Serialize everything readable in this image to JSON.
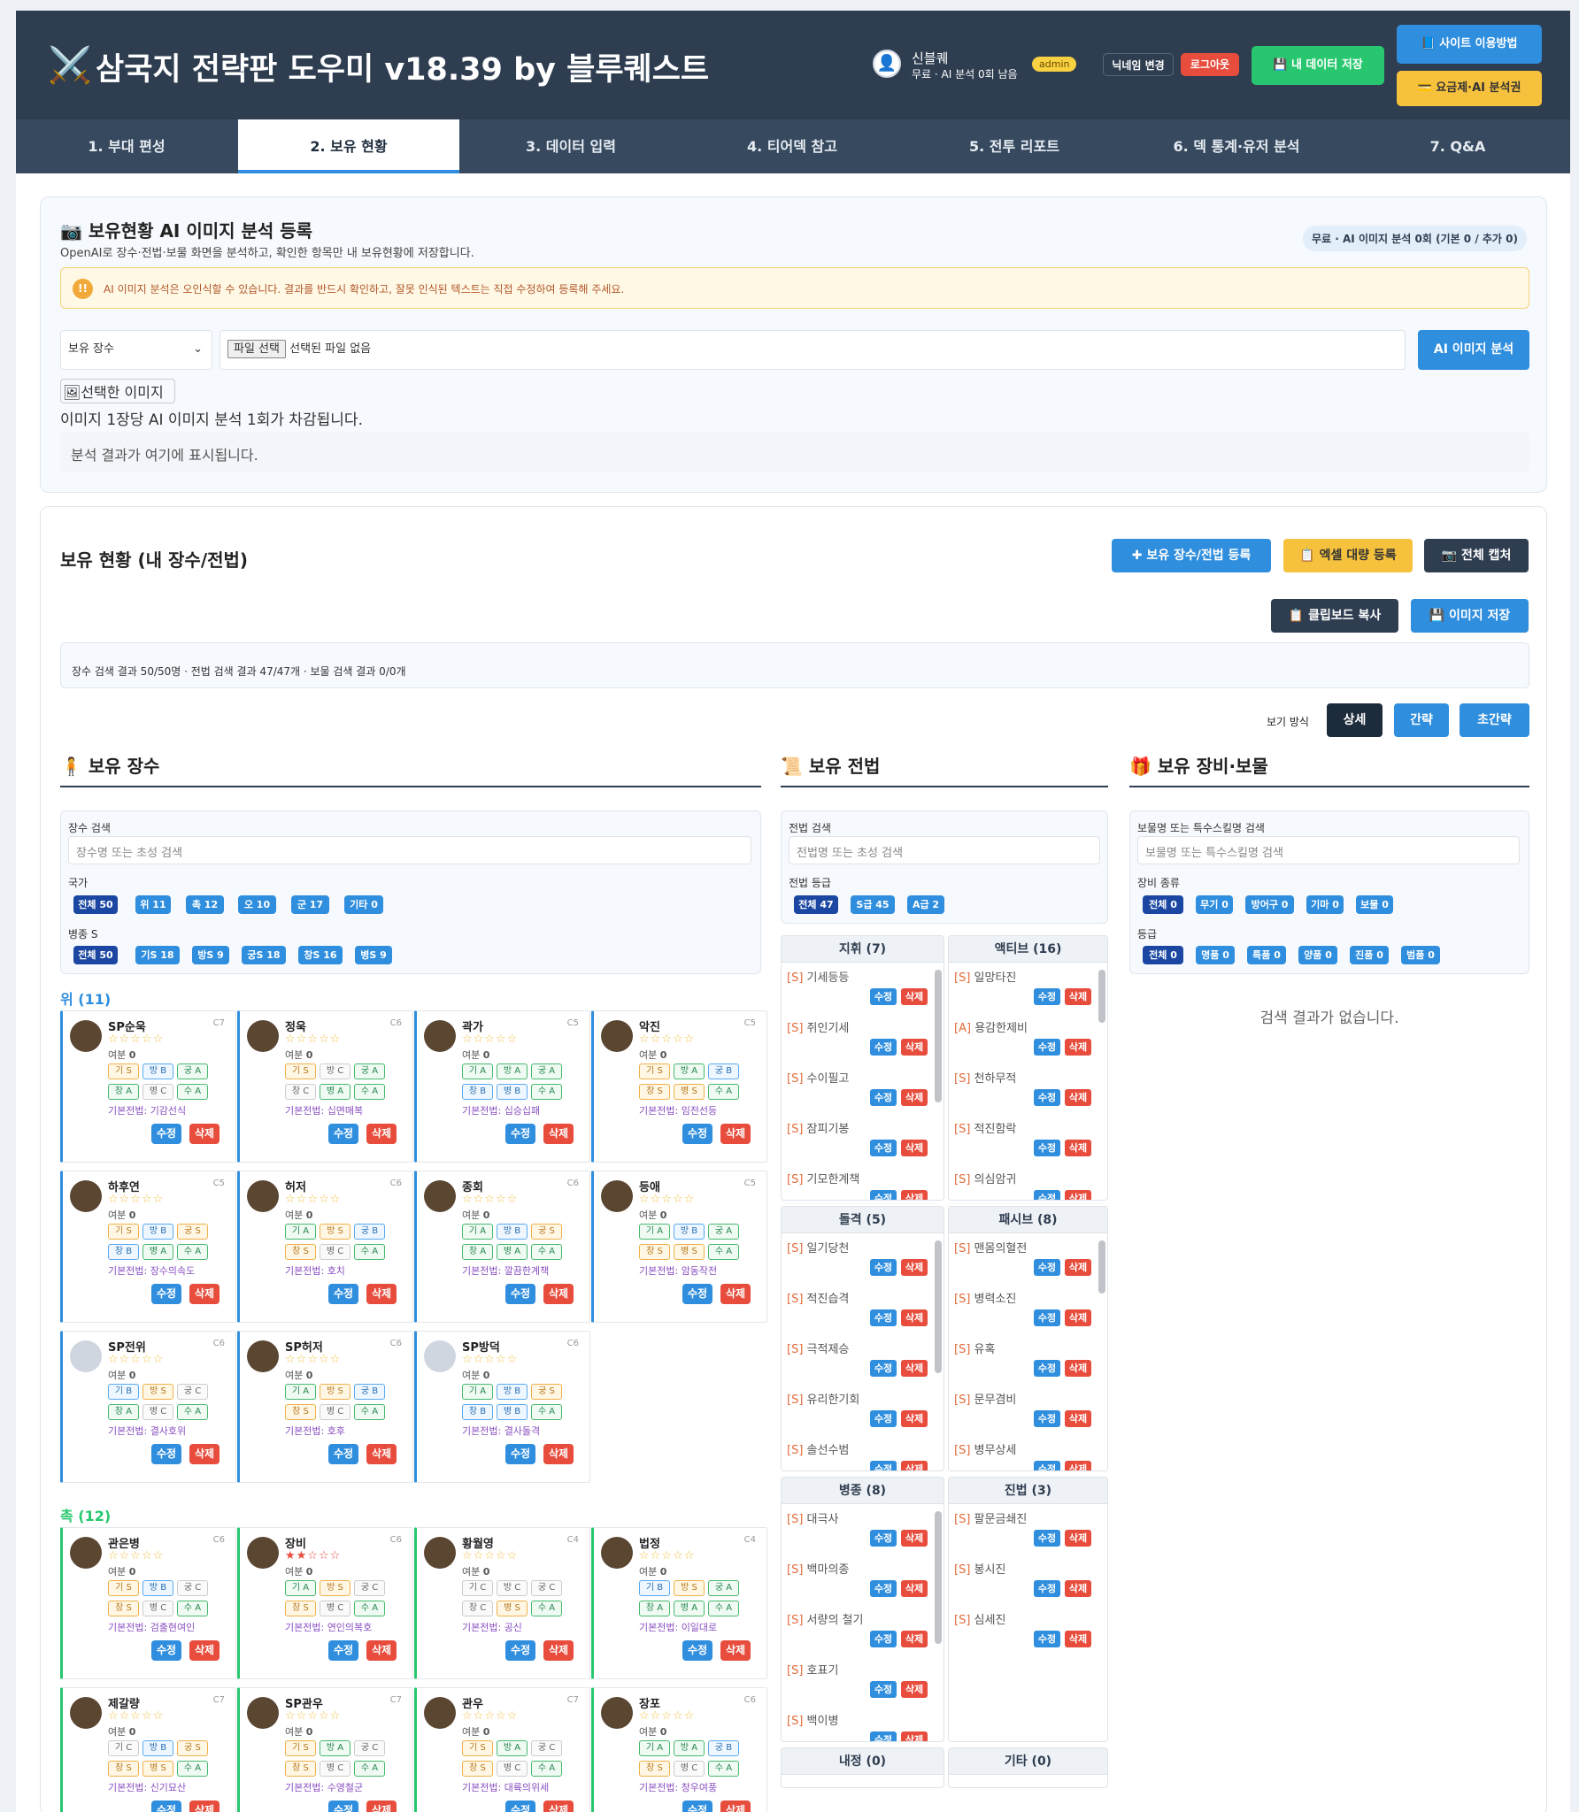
{
  "app": {
    "title": "삼국지 전략판 도우미 v18.39 by 블루퀘스트",
    "user": "신블퀘",
    "quota": "무료 · AI 분석 0회 남음",
    "role": "admin",
    "rename": "닉네임 변경",
    "logout": "로그아웃",
    "save_data": "💾 내 데이터 저장",
    "how_to": "📘 사이트 이용방법",
    "plans": "💳 요금제·AI 분석권"
  },
  "tabs": [
    "1. 부대 편성",
    "2. 보유 현황",
    "3. 데이터 입력",
    "4. 티어덱 참고",
    "5. 전투 리포트",
    "6. 덱 통계·유저 분석",
    "7. Q&A"
  ],
  "ai": {
    "title": "보유현황 AI 이미지 분석 등록",
    "desc": "OpenAI로 장수·전법·보물 화면을 분석하고, 확인한 항목만 내 보유현황에 저장합니다.",
    "badge": "무료 · AI 이미지 분석 0회 (기본 0 / 추가 0)",
    "warn": "AI 이미지 분석은 오인식할 수 있습니다. 결과를 반드시 확인하고, 잘못 인식된 텍스트는 직접 수정하여 등록해 주세요.",
    "select": "보유 장수",
    "file_btn": "파일 선택",
    "file_none": "선택된 파일 없음",
    "analyze": "AI 이미지 분석",
    "img_alt": "선택한 이미지",
    "note": "이미지 1장당 AI 이미지 분석 1회가 차감됩니다.",
    "result": "분석 결과가 여기에 표시됩니다."
  },
  "holdings": {
    "title": "보유 현황 (내 장수/전법)",
    "register": "보유 장수/전법 등록",
    "excel": "엑셀 대량 등록",
    "capture": "전체 캡처",
    "clipboard": "클립보드 복사",
    "save_img": "이미지 저장",
    "summary": "장수 검색 결과 50/50명 · 전법 검색 결과 47/47개 · 보물 검색 결과 0/0개",
    "view_label": "보기 방식",
    "views": [
      "상세",
      "간략",
      "초간략"
    ]
  },
  "generals": {
    "title": "보유 장수",
    "search_label": "장수 검색",
    "search_ph": "장수명 또는 초성 검색",
    "country_label": "국가",
    "countries": [
      "전체 50",
      "위 11",
      "촉 12",
      "오 10",
      "군 17",
      "기타 0"
    ],
    "troop_label": "병종 S",
    "troops": [
      "전체 50",
      "기S 18",
      "방S 9",
      "궁S 18",
      "창S 16",
      "병S 9"
    ],
    "wei": "위 (11)",
    "shu": "촉 (12)",
    "yb": "여분",
    "base": "기본전법: ",
    "edit": "수정",
    "del": "삭제",
    "wei_cards": [
      {
        "name": "SP순욱",
        "cost": "C7",
        "stars": "☆☆☆☆☆",
        "yb": "0",
        "r": [
          "기 S",
          "방 B",
          "궁 A",
          "창 A",
          "병 C",
          "수 A"
        ],
        "skill": "기감선식"
      },
      {
        "name": "정욱",
        "cost": "C6",
        "stars": "☆☆☆☆☆",
        "yb": "0",
        "r": [
          "기 S",
          "방 C",
          "궁 A",
          "창 C",
          "병 A",
          "수 A"
        ],
        "skill": "십면매복"
      },
      {
        "name": "곽가",
        "cost": "C5",
        "stars": "☆☆☆☆☆",
        "yb": "0",
        "r": [
          "기 A",
          "방 A",
          "궁 A",
          "창 B",
          "병 B",
          "수 A"
        ],
        "skill": "십승십패"
      },
      {
        "name": "악진",
        "cost": "C5",
        "stars": "☆☆☆☆☆",
        "yb": "0",
        "r": [
          "기 S",
          "방 A",
          "궁 B",
          "창 S",
          "병 S",
          "수 A"
        ],
        "skill": "임전선등"
      },
      {
        "name": "하후연",
        "cost": "C5",
        "stars": "☆☆☆☆☆",
        "yb": "0",
        "r": [
          "기 S",
          "방 B",
          "궁 S",
          "창 B",
          "병 A",
          "수 A"
        ],
        "skill": "장수의속도"
      },
      {
        "name": "허저",
        "cost": "C6",
        "stars": "☆☆☆☆☆",
        "yb": "0",
        "r": [
          "기 A",
          "방 S",
          "궁 B",
          "창 S",
          "병 C",
          "수 A"
        ],
        "skill": "호치"
      },
      {
        "name": "종회",
        "cost": "C6",
        "stars": "☆☆☆☆☆",
        "yb": "0",
        "r": [
          "기 A",
          "방 B",
          "궁 S",
          "창 A",
          "병 A",
          "수 A"
        ],
        "skill": "깔끔한계책"
      },
      {
        "name": "등애",
        "cost": "C5",
        "stars": "☆☆☆☆☆",
        "yb": "0",
        "r": [
          "기 A",
          "방 B",
          "궁 A",
          "창 S",
          "병 S",
          "수 A"
        ],
        "skill": "암동작전"
      },
      {
        "name": "SP전위",
        "cost": "C6",
        "stars": "☆☆☆☆☆",
        "yb": "0",
        "r": [
          "기 B",
          "방 S",
          "궁 C",
          "창 A",
          "병 C",
          "수 A"
        ],
        "skill": "결사호위"
      },
      {
        "name": "SP허저",
        "cost": "C6",
        "stars": "☆☆☆☆☆",
        "yb": "0",
        "r": [
          "기 A",
          "방 S",
          "궁 B",
          "창 S",
          "병 C",
          "수 A"
        ],
        "skill": "호후"
      },
      {
        "name": "SP방덕",
        "cost": "C6",
        "stars": "☆☆☆☆☆",
        "yb": "0",
        "r": [
          "기 A",
          "방 B",
          "궁 S",
          "창 B",
          "병 B",
          "수 A"
        ],
        "skill": "결사돌격"
      }
    ],
    "shu_cards": [
      {
        "name": "관은병",
        "cost": "C6",
        "stars": "☆☆☆☆☆",
        "yb": "0",
        "r": [
          "기 S",
          "방 B",
          "궁 C",
          "창 S",
          "병 C",
          "수 A"
        ],
        "skill": "검출현여인"
      },
      {
        "name": "장비",
        "cost": "C6",
        "stars": "★★☆☆☆",
        "yb": "0",
        "r": [
          "기 A",
          "방 S",
          "궁 C",
          "창 S",
          "병 C",
          "수 A"
        ],
        "skill": "연인의복호"
      },
      {
        "name": "황월영",
        "cost": "C4",
        "stars": "☆☆☆☆☆",
        "yb": "0",
        "r": [
          "기 C",
          "방 C",
          "궁 C",
          "창 C",
          "병 S",
          "수 A"
        ],
        "skill": "공신"
      },
      {
        "name": "법정",
        "cost": "C4",
        "stars": "☆☆☆☆☆",
        "yb": "0",
        "r": [
          "기 B",
          "방 S",
          "궁 A",
          "창 A",
          "병 A",
          "수 A"
        ],
        "skill": "이일대로"
      },
      {
        "name": "제갈량",
        "cost": "C7",
        "stars": "☆☆☆☆☆",
        "yb": "0",
        "r": [
          "기 C",
          "방 B",
          "궁 S",
          "창 S",
          "병 S",
          "수 A"
        ],
        "skill": "신기묘산"
      },
      {
        "name": "SP관우",
        "cost": "C7",
        "stars": "☆☆☆☆☆",
        "yb": "0",
        "r": [
          "기 S",
          "방 A",
          "궁 C",
          "창 S",
          "병 C",
          "수 A"
        ],
        "skill": "수영철군"
      },
      {
        "name": "관우",
        "cost": "C7",
        "stars": "☆☆☆☆☆",
        "yb": "0",
        "r": [
          "기 S",
          "방 A",
          "궁 C",
          "창 S",
          "병 C",
          "수 A"
        ],
        "skill": "대륙의위세"
      },
      {
        "name": "장포",
        "cost": "C6",
        "stars": "☆☆☆☆☆",
        "yb": "0",
        "r": [
          "기 A",
          "방 A",
          "궁 B",
          "창 S",
          "병 C",
          "수 A"
        ],
        "skill": "창우여풍"
      }
    ]
  },
  "tactics": {
    "title": "보유 전법",
    "search_label": "전법 검색",
    "search_ph": "전법명 또는 초성 검색",
    "grade_label": "전법 등급",
    "grades": [
      "전체 47",
      "S급 45",
      "A급 2"
    ],
    "boxes": [
      {
        "h": "지휘 (7)",
        "items": [
          [
            "[S]",
            "기세등등"
          ],
          [
            "[S]",
            "쥐인기세"
          ],
          [
            "[S]",
            "수이필고"
          ],
          [
            "[S]",
            "잠피기봉"
          ],
          [
            "[S]",
            "기모한계책"
          ]
        ]
      },
      {
        "h": "액티브 (16)",
        "items": [
          [
            "[S]",
            "일망타진"
          ],
          [
            "[A]",
            "용감한제비"
          ],
          [
            "[S]",
            "천하무적"
          ],
          [
            "[S]",
            "적진함락"
          ],
          [
            "[S]",
            "의심암귀"
          ]
        ]
      },
      {
        "h": "돌격 (5)",
        "items": [
          [
            "[S]",
            "일기당천"
          ],
          [
            "[S]",
            "적진습격"
          ],
          [
            "[S]",
            "극적제승"
          ],
          [
            "[S]",
            "유리한기회"
          ],
          [
            "[S]",
            "솔선수범"
          ]
        ]
      },
      {
        "h": "패시브 (8)",
        "items": [
          [
            "[S]",
            "맨몸의혈전"
          ],
          [
            "[S]",
            "병력소진"
          ],
          [
            "[S]",
            "유혹"
          ],
          [
            "[S]",
            "문무겸비"
          ],
          [
            "[S]",
            "병무상세"
          ]
        ]
      },
      {
        "h": "병종 (8)",
        "items": [
          [
            "[S]",
            "대극사"
          ],
          [
            "[S]",
            "백마의종"
          ],
          [
            "[S]",
            "서량의 철기"
          ],
          [
            "[S]",
            "호표기"
          ],
          [
            "[S]",
            "백이병"
          ]
        ]
      },
      {
        "h": "진법 (3)",
        "items": [
          [
            "[S]",
            "팔문금쇄진"
          ],
          [
            "[S]",
            "봉시진"
          ],
          [
            "[S]",
            "심세진"
          ]
        ]
      },
      {
        "h": "내정 (0)",
        "items": []
      },
      {
        "h": "기타 (0)",
        "items": []
      }
    ]
  },
  "treasures": {
    "title": "보유 장비·보물",
    "search_label": "보물명 또는 특수스킬명 검색",
    "search_ph": "보물명 또는 특수스킬명 검색",
    "kind_label": "장비 종류",
    "kinds": [
      "전체 0",
      "무기 0",
      "방어구 0",
      "기마 0",
      "보물 0"
    ],
    "grade_label": "등급",
    "grades": [
      "전체 0",
      "명품 0",
      "특품 0",
      "양품 0",
      "진품 0",
      "범품 0"
    ],
    "empty": "검색 결과가 없습니다."
  }
}
